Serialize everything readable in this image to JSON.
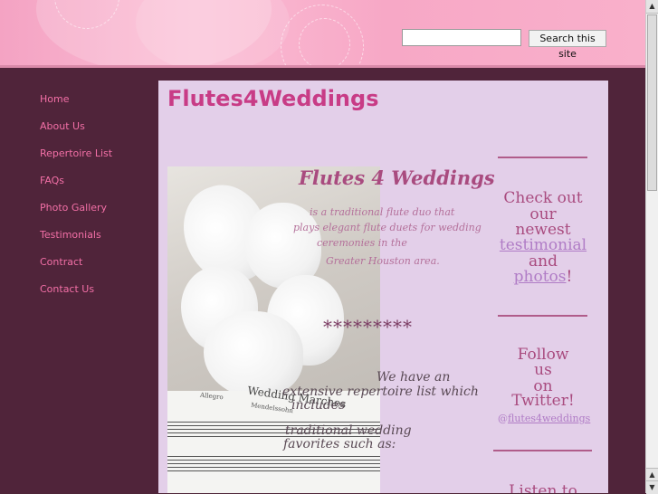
{
  "search": {
    "placeholder": "",
    "button_label": "Search this site"
  },
  "nav": {
    "items": [
      {
        "label": "Home"
      },
      {
        "label": "About Us"
      },
      {
        "label": "Repertoire List"
      },
      {
        "label": "FAQs"
      },
      {
        "label": "Photo Gallery"
      },
      {
        "label": "Testimonials"
      },
      {
        "label": "Contract"
      },
      {
        "label": "Contact Us"
      }
    ]
  },
  "main": {
    "title": "Flutes4Weddings",
    "promo_title": "Flutes 4 Weddings",
    "intro_lines": [
      "is a traditional flute duo that",
      "plays elegant flute duets for wedding",
      "ceremonies in the",
      "Greater Houston area."
    ],
    "stars": "*********",
    "rep_lines": [
      "We have an",
      "extensive repertoire list which",
      "includes",
      "traditional wedding",
      "favorites such as:"
    ],
    "sheet_text": [
      "Wedding Marches",
      "Allegro",
      "Mendelssohn"
    ]
  },
  "sidebar": {
    "check_out": [
      "Check out",
      "our",
      "newest"
    ],
    "testimonial_link": "testimonial",
    "and": "and",
    "photos_link": "photos",
    "exclaim": "!",
    "follow": [
      "Follow",
      "us",
      "on",
      "Twitter!"
    ],
    "handle_prefix": "@",
    "handle_link": "flutes4weddings",
    "listen": "Listen to"
  },
  "colors": {
    "accent": "#c83c86",
    "nav_link": "#f26fa6",
    "link": "#b07cc6",
    "content_bg": "#e3cfe9",
    "page_bg": "#50243a"
  },
  "icons": {
    "scroll_up": "scroll-up-arrow-icon",
    "scroll_down": "scroll-down-arrow-icon"
  }
}
